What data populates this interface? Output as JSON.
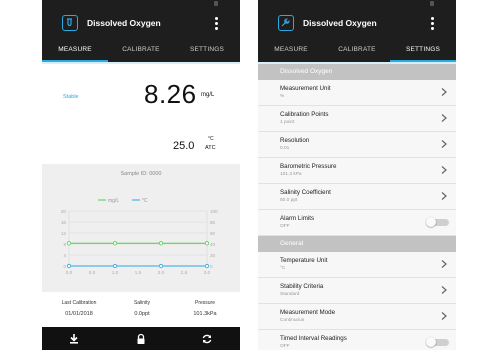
{
  "app": {
    "title": "Dissolved Oxygen",
    "accent": "#2ba9e1"
  },
  "tabs": [
    {
      "label": "MEASURE"
    },
    {
      "label": "CALIBRATE"
    },
    {
      "label": "SETTINGS"
    }
  ],
  "measure": {
    "status": "Stable",
    "do_value": "8.26",
    "do_unit": "mg/L",
    "temp_value": "25.0",
    "temp_unit": "°C",
    "temp_mode": "ATC",
    "sample_id": "Sample ID: 0000"
  },
  "chart_data": {
    "type": "line",
    "legend": [
      "mg/L",
      "°C"
    ],
    "x": [
      0.0,
      0.5,
      1.0,
      1.5,
      2.0,
      2.5,
      3.0
    ],
    "x_tick_labels": [
      "0.0",
      "0.5",
      "1.0",
      "1.5",
      "2.0",
      "2.5",
      "3.0"
    ],
    "y_left_ticks": [
      "0",
      "4",
      "8",
      "12",
      "16",
      "20"
    ],
    "y_right_ticks": [
      "0",
      "20",
      "40",
      "60",
      "80",
      "100"
    ],
    "ylim_left": [
      0,
      20
    ],
    "ylim_right": [
      0,
      100
    ],
    "series": [
      {
        "name": "mg/L",
        "axis": "left",
        "color": "#4cd04c",
        "x": [
          0.0,
          1.0,
          2.0,
          3.0
        ],
        "values": [
          8.26,
          8.26,
          8.26,
          8.26
        ]
      },
      {
        "name": "°C",
        "axis": "right",
        "color": "#2ba9e1",
        "x": [
          0.0,
          1.0,
          2.0,
          3.0
        ],
        "values": [
          0,
          0,
          0,
          0
        ]
      }
    ]
  },
  "stats": {
    "last_calibration_label": "Last Calibration",
    "last_calibration_value": "01/01/2018",
    "salinity_label": "Salinity",
    "salinity_value": "0.0ppt",
    "pressure_label": "Pressure",
    "pressure_value": "101.3kPa"
  },
  "bottom_icons": [
    "download-icon",
    "lock-icon",
    "refresh-icon"
  ],
  "settings": {
    "section1": "Dissolved Oxygen",
    "section2": "General",
    "rows1": [
      {
        "label": "Measurement Unit",
        "value": "%"
      },
      {
        "label": "Calibration Points",
        "value": "1 point"
      },
      {
        "label": "Resolution",
        "value": "0.01"
      },
      {
        "label": "Barometric Pressure",
        "value": "101.3 kPa"
      },
      {
        "label": "Salinity Coefficient",
        "value": "50.0 ppt"
      },
      {
        "label": "Alarm Limits",
        "value": "OFF"
      }
    ],
    "rows2": [
      {
        "label": "Temperature Unit",
        "value": "°C"
      },
      {
        "label": "Stability Criteria",
        "value": "Standard"
      },
      {
        "label": "Measurement Mode",
        "value": "Continuous"
      },
      {
        "label": "Timed Interval Readings",
        "value": "OFF"
      }
    ]
  }
}
